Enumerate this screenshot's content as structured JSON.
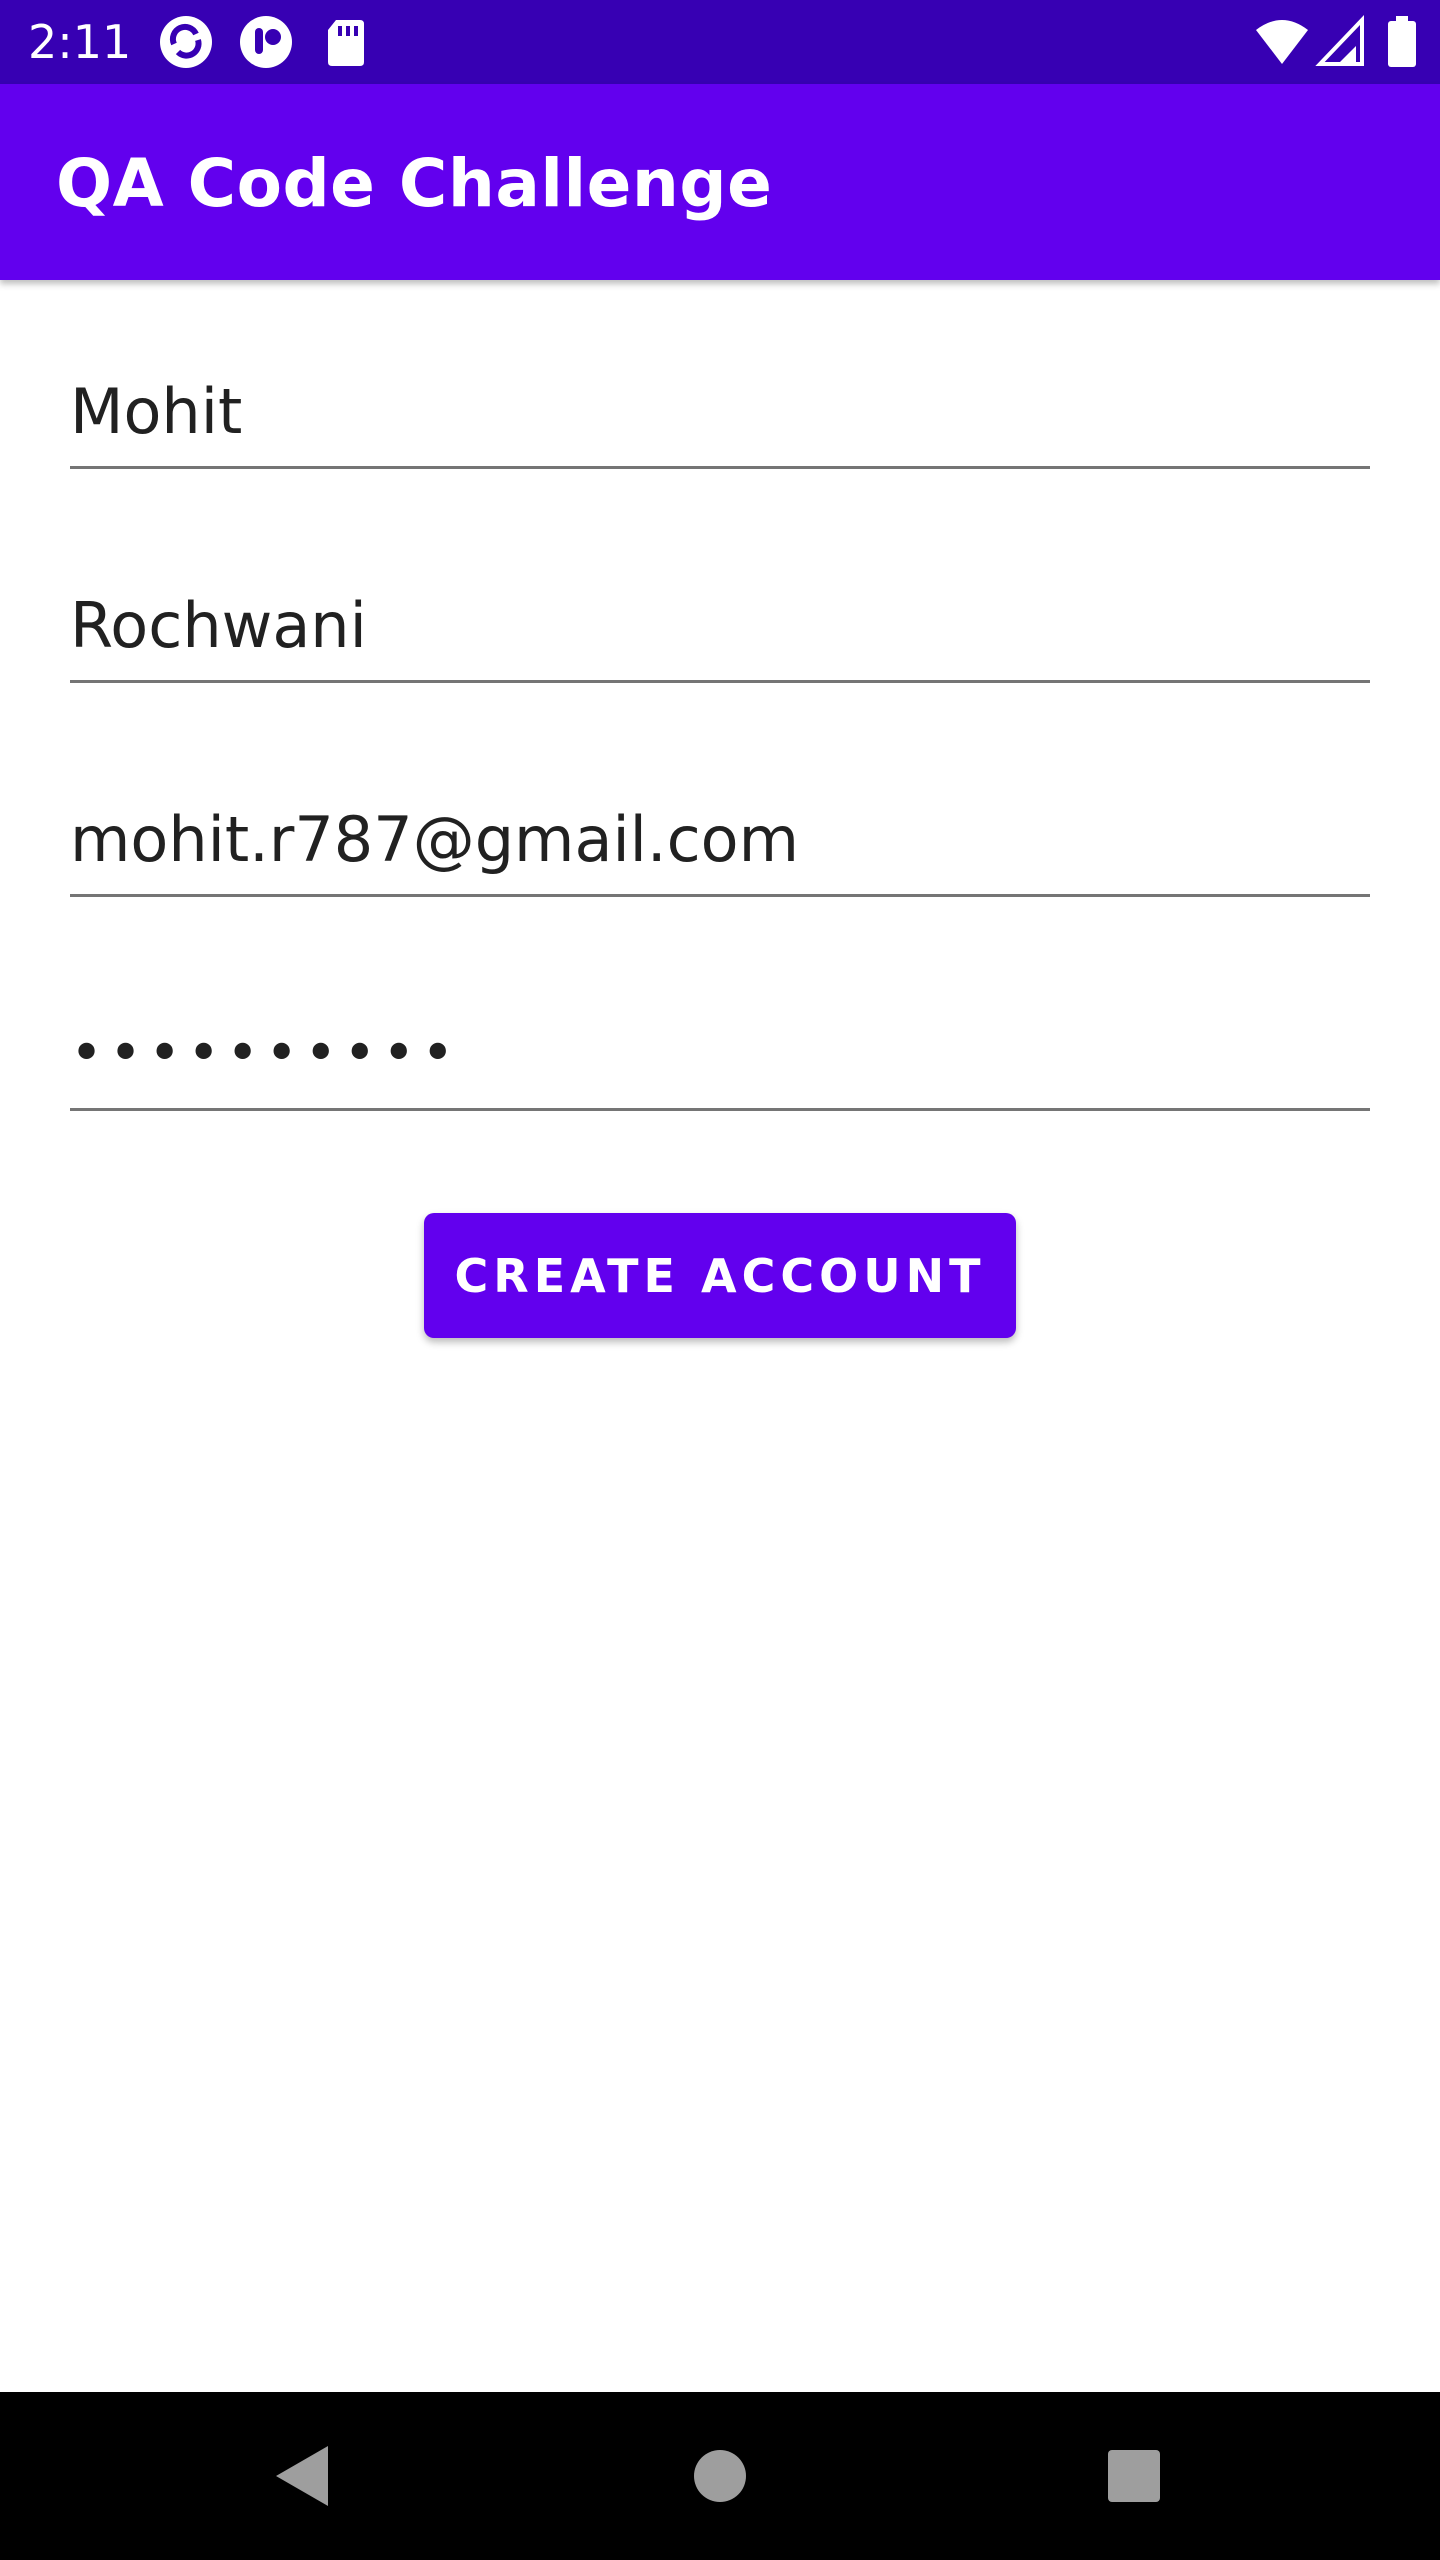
{
  "status_bar": {
    "time": "2:11",
    "left_icons": [
      "sync-app-icon",
      "notification-app-icon",
      "sd-card-icon"
    ],
    "right_icons": [
      "wifi-icon",
      "cell-signal-icon",
      "battery-icon"
    ],
    "colors": {
      "background": "#3700b3"
    }
  },
  "app_bar": {
    "title": "QA Code Challenge",
    "colors": {
      "background": "#6200ee"
    }
  },
  "form": {
    "first_name_value": "Mohit",
    "last_name_value": "Rochwani",
    "email_value": "mohit.r787@gmail.com",
    "password_masked": "••••••••••",
    "submit_label": "CREATE ACCOUNT",
    "colors": {
      "button": "#6200ee",
      "underline": "#757575"
    }
  },
  "nav_bar": {
    "icons": [
      "back-icon",
      "home-icon",
      "recents-icon"
    ],
    "colors": {
      "background": "#000000",
      "icon": "#9e9e9e"
    }
  }
}
